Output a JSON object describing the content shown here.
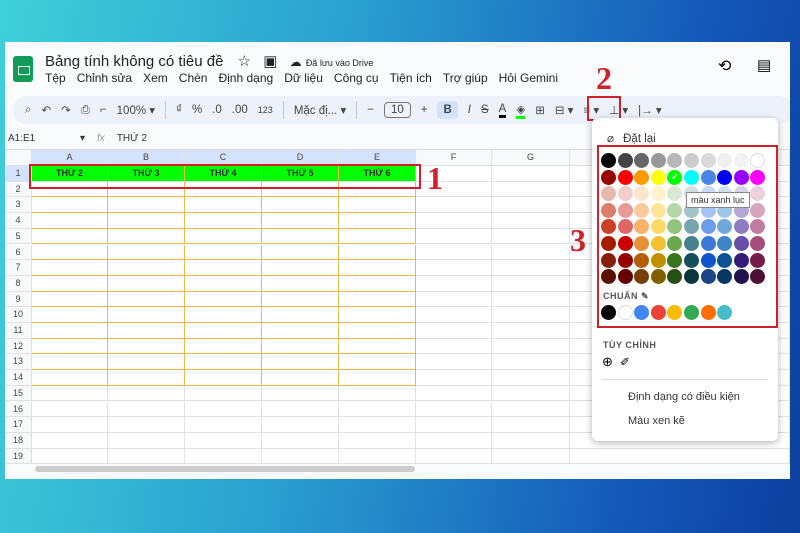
{
  "app": {
    "title": "Bảng tính không có tiêu đề",
    "save_status": "Đã lưu vào Drive",
    "menu": [
      "Tệp",
      "Chỉnh sửa",
      "Xem",
      "Chèn",
      "Định dạng",
      "Dữ liệu",
      "Công cụ",
      "Tiện ích",
      "Trợ giúp",
      "Hỏi Gemini"
    ]
  },
  "toolbar": {
    "zoom": "100%",
    "currency": "₫",
    "percent": "%",
    "dec_less": ".0",
    "dec_more": ".00",
    "number_format": "123",
    "font": "Mặc đị...",
    "font_size": "10",
    "bold": "B",
    "italic": "I",
    "strike": "S",
    "text_color": "A"
  },
  "formula_bar": {
    "name_box": "A1:E1",
    "fx": "fx",
    "content": "THỨ 2"
  },
  "grid": {
    "columns": [
      "A",
      "B",
      "C",
      "D",
      "E",
      "F",
      "G"
    ],
    "rows": 19,
    "row1": [
      "THỨ 2",
      "THỨ 3",
      "THỨ 4",
      "THỨ 5",
      "THỨ 6"
    ],
    "fill_color": "#00ff00",
    "border_color": "#f1b74a"
  },
  "palette": {
    "reset": "Đặt lại",
    "tooltip": "màu xanh lục",
    "standard_label": "CHUẨN",
    "custom_label": "TÙY CHỈNH",
    "conditional": "Định dạng có điều kiện",
    "alternating": "Màu xen kẽ",
    "selected": "#00ff00",
    "colors": [
      [
        "#000000",
        "#434343",
        "#666666",
        "#999999",
        "#b7b7b7",
        "#cccccc",
        "#d9d9d9",
        "#efefef",
        "#f3f3f3",
        "#ffffff"
      ],
      [
        "#980000",
        "#ff0000",
        "#ff9900",
        "#ffff00",
        "#00ff00",
        "#00ffff",
        "#4a86e8",
        "#0000ff",
        "#9900ff",
        "#ff00ff"
      ],
      [
        "#e6b8af",
        "#f4cccc",
        "#fce5cd",
        "#fff2cc",
        "#d9ead3",
        "#d0e0e3",
        "#c9daf8",
        "#cfe2f3",
        "#d9d2e9",
        "#ead1dc"
      ],
      [
        "#dd7e6b",
        "#ea9999",
        "#f9cb9c",
        "#ffe599",
        "#b6d7a8",
        "#a2c4c9",
        "#a4c2f4",
        "#9fc5e8",
        "#b4a7d6",
        "#d5a6bd"
      ],
      [
        "#cc4125",
        "#e06666",
        "#f6b26b",
        "#ffd966",
        "#93c47d",
        "#76a5af",
        "#6d9eeb",
        "#6fa8dc",
        "#8e7cc3",
        "#c27ba0"
      ],
      [
        "#a61c00",
        "#cc0000",
        "#e69138",
        "#f1c232",
        "#6aa84f",
        "#45818e",
        "#3c78d8",
        "#3d85c6",
        "#674ea7",
        "#a64d79"
      ],
      [
        "#85200c",
        "#990000",
        "#b45f06",
        "#bf9000",
        "#38761d",
        "#134f5c",
        "#1155cc",
        "#0b5394",
        "#351c75",
        "#741b47"
      ],
      [
        "#5b0f00",
        "#660000",
        "#783f04",
        "#7f6000",
        "#274e13",
        "#0c343d",
        "#1c4587",
        "#073763",
        "#20124d",
        "#4c1130"
      ]
    ],
    "standard": [
      "#000000",
      "#ffffff",
      "#4285f4",
      "#ea4335",
      "#fbbc04",
      "#34a853",
      "#ff6d01",
      "#46bdc6"
    ]
  },
  "annotations": [
    "1",
    "2",
    "3"
  ]
}
